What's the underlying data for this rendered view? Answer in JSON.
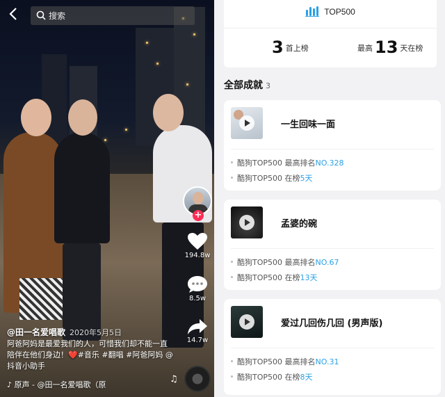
{
  "search": {
    "placeholder": "搜索"
  },
  "video": {
    "author": "@田一名爱唱歌",
    "date": "2020年5月5日",
    "caption": "阿爸阿妈是最爱我们的人，可惜我们却不能一直陪伴在他们身边！❤️#音乐 #翻唱 #阿爸阿妈 @抖音小助手",
    "music": "原声 - @田一名爱唱歌（原",
    "likes": "194.8w",
    "comments": "8.5w",
    "shares": "14.7w"
  },
  "summary": {
    "brand": "TOP500",
    "chart_count": "3",
    "chart_count_label": "首上榜",
    "max_label": "最高",
    "max_days": "13",
    "max_days_label": "天在榜"
  },
  "achievements": {
    "title": "全部成就",
    "count": "3",
    "items": [
      {
        "song": "一生回味一面",
        "rank_prefix": "酷狗TOP500 最高排名",
        "rank": "NO.328",
        "days_prefix": "酷狗TOP500 在榜",
        "days": "5天"
      },
      {
        "song": "孟婆的碗",
        "rank_prefix": "酷狗TOP500 最高排名",
        "rank": "NO.67",
        "days_prefix": "酷狗TOP500 在榜",
        "days": "13天"
      },
      {
        "song": "爱过几回伤几回 (男声版)",
        "rank_prefix": "酷狗TOP500 最高排名",
        "rank": "NO.31",
        "days_prefix": "酷狗TOP500 在榜",
        "days": "8天"
      }
    ]
  },
  "colors": {
    "accent": "#2ba0e5",
    "like": "#ffffff",
    "follow": "#ff2d55"
  }
}
